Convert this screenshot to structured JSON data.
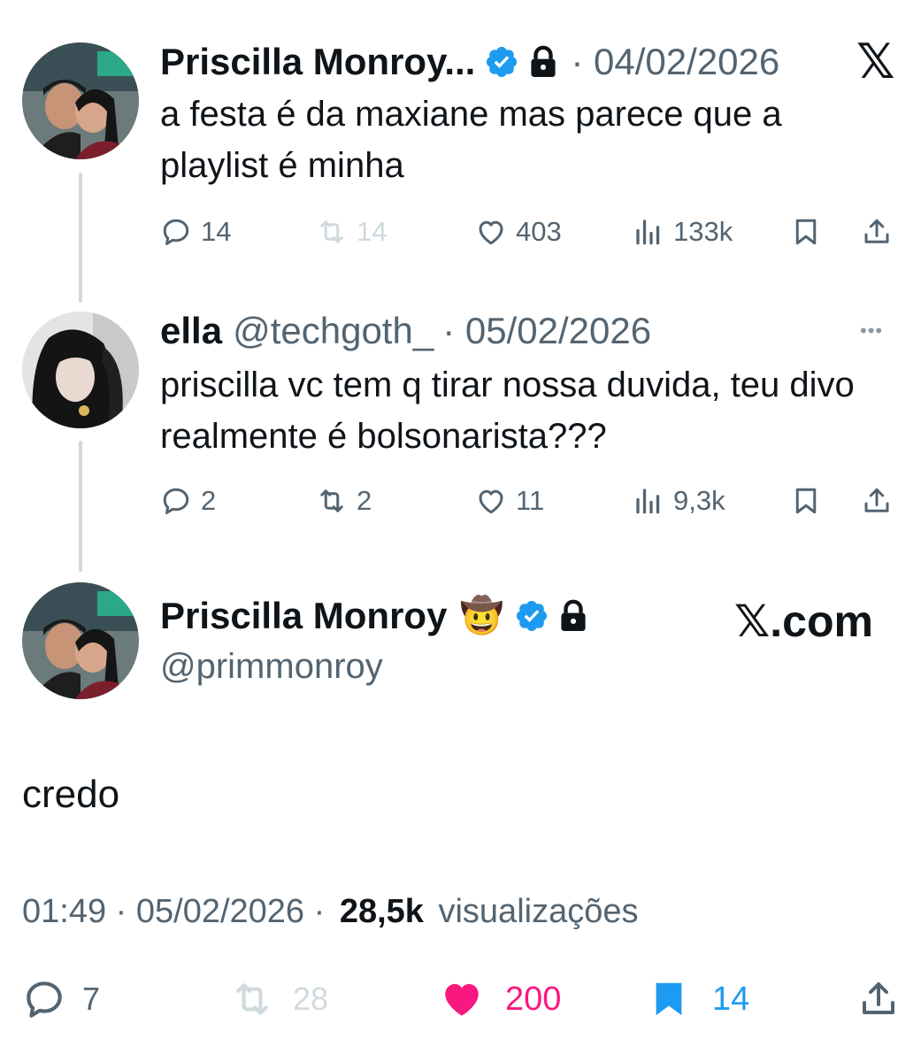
{
  "tweet1": {
    "name": "Priscilla Monroy...",
    "date": "· 04/02/2026",
    "text": "a festa é da maxiane mas parece que a playlist é minha",
    "replies": "14",
    "retweets": "14",
    "likes": "403",
    "views": "133k"
  },
  "tweet2": {
    "name": "ella",
    "handle": "@techgoth_",
    "date": "· 05/02/2026",
    "text": "priscilla vc tem q tirar nossa duvida, teu divo realmente é bolsonarista???",
    "replies": "2",
    "retweets": "2",
    "likes": "11",
    "views": "9,3k",
    "more_icon": "•••"
  },
  "main": {
    "name": "Priscilla Monroy",
    "emoji": "🤠",
    "handle": "@primmonroy",
    "brand": "𝕏.com",
    "text": "credo",
    "time": "01:49 · 05/02/2026 ·",
    "views_count": "28,5k",
    "views_label": "visualizações",
    "replies": "7",
    "retweets": "28",
    "likes": "200",
    "bookmarks": "14"
  },
  "x_logo": "𝕏",
  "colors": {
    "text": "#0f1419",
    "muted": "#536471",
    "verified": "#1d9bf0",
    "like_active": "#f91880",
    "bookmark_active": "#1d9bf0",
    "thread_line": "#cfd9de"
  }
}
